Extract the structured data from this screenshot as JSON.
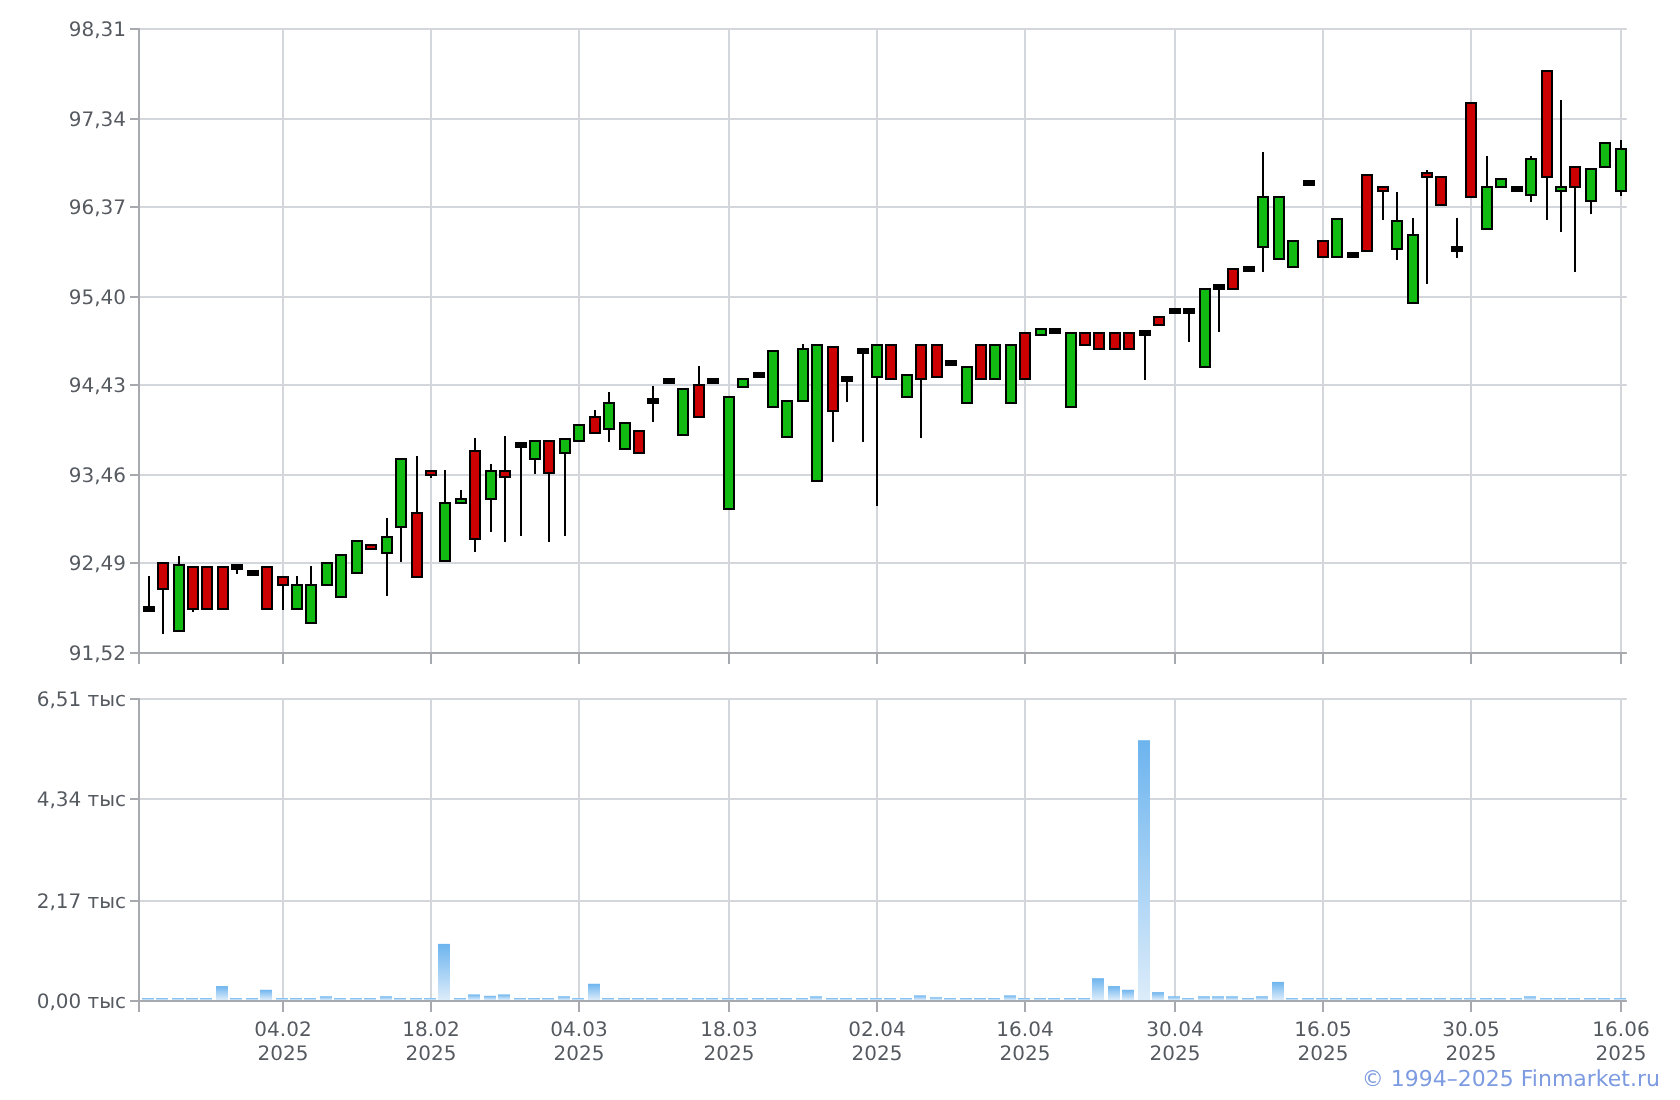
{
  "price_chart": {
    "chart_data": {
      "type": "candlestick",
      "grid": true,
      "ylim": [
        91.52,
        98.31
      ],
      "yticks": [
        {
          "value": 98.31,
          "label": "98,31"
        },
        {
          "value": 97.34,
          "label": "97,34"
        },
        {
          "value": 96.37,
          "label": "96,37"
        },
        {
          "value": 95.4,
          "label": "95,40"
        },
        {
          "value": 94.43,
          "label": "94,43"
        },
        {
          "value": 93.46,
          "label": "93,46"
        },
        {
          "value": 92.49,
          "label": "92,49"
        },
        {
          "value": 91.52,
          "label": "91,52"
        }
      ],
      "categories": [
        null,
        null,
        null,
        null,
        null,
        null,
        null,
        null,
        null,
        null,
        null,
        null,
        null,
        null,
        null,
        null,
        null,
        null,
        null,
        null,
        null,
        null,
        null,
        null,
        null,
        null,
        null,
        null,
        null,
        null,
        null,
        null,
        null,
        null,
        null,
        null,
        null,
        null,
        null,
        null,
        null,
        null,
        null,
        null,
        null,
        null,
        null,
        null,
        null,
        null,
        null,
        null,
        null,
        null,
        null,
        null,
        null,
        null,
        null,
        null,
        null,
        null,
        null,
        null,
        null,
        null,
        null,
        null,
        null,
        null,
        null,
        null,
        null,
        null,
        null,
        null,
        null,
        null,
        null,
        null,
        null,
        null,
        null,
        null,
        null,
        null,
        null,
        null,
        null,
        null,
        null,
        null,
        null,
        null,
        null,
        null,
        null,
        null,
        null,
        null
      ],
      "ohlc": [
        [
          92.0,
          92.35,
          92.0,
          92.0
        ],
        [
          92.5,
          92.5,
          91.74,
          92.22
        ],
        [
          91.76,
          92.57,
          91.76,
          92.48
        ],
        [
          92.46,
          92.46,
          91.98,
          92.0
        ],
        [
          92.46,
          92.46,
          92.0,
          92.0
        ],
        [
          92.46,
          92.46,
          92.0,
          92.0
        ],
        [
          92.46,
          92.46,
          92.39,
          92.46
        ],
        [
          92.39,
          92.39,
          92.39,
          92.39
        ],
        [
          92.46,
          92.46,
          92.0,
          92.0
        ],
        [
          92.35,
          92.35,
          92.0,
          92.26
        ],
        [
          92.0,
          92.35,
          92.0,
          92.26
        ],
        [
          91.85,
          92.46,
          91.85,
          92.26
        ],
        [
          92.26,
          92.5,
          92.26,
          92.5
        ],
        [
          92.13,
          92.59,
          92.13,
          92.59
        ],
        [
          92.39,
          92.74,
          92.39,
          92.74
        ],
        [
          92.7,
          92.7,
          92.65,
          92.65
        ],
        [
          92.61,
          92.98,
          92.15,
          92.78
        ],
        [
          92.89,
          93.63,
          92.52,
          93.63
        ],
        [
          93.04,
          93.65,
          92.35,
          92.35
        ],
        [
          93.5,
          93.5,
          93.44,
          93.46
        ],
        [
          92.52,
          93.5,
          92.52,
          93.15
        ],
        [
          93.15,
          93.28,
          93.15,
          93.2
        ],
        [
          93.72,
          93.85,
          92.63,
          92.76
        ],
        [
          93.2,
          93.57,
          92.85,
          93.5
        ],
        [
          93.5,
          93.87,
          92.74,
          93.44
        ],
        [
          93.78,
          93.78,
          92.8,
          93.78
        ],
        [
          93.63,
          93.83,
          93.48,
          93.83
        ],
        [
          93.83,
          93.83,
          92.74,
          93.48
        ],
        [
          93.7,
          93.85,
          92.8,
          93.85
        ],
        [
          93.83,
          94.0,
          93.83,
          94.0
        ],
        [
          94.09,
          94.15,
          93.92,
          93.92
        ],
        [
          93.96,
          94.35,
          93.83,
          94.24
        ],
        [
          93.74,
          94.02,
          93.74,
          94.02
        ],
        [
          93.94,
          93.94,
          93.7,
          93.7
        ],
        [
          94.26,
          94.41,
          94.05,
          94.26
        ],
        [
          94.48,
          94.48,
          94.48,
          94.48
        ],
        [
          93.89,
          94.39,
          93.89,
          94.39
        ],
        [
          94.44,
          94.63,
          94.09,
          94.09
        ],
        [
          94.48,
          94.48,
          94.48,
          94.48
        ],
        [
          93.09,
          94.31,
          93.09,
          94.31
        ],
        [
          94.41,
          94.5,
          94.41,
          94.5
        ],
        [
          94.55,
          94.55,
          94.55,
          94.55
        ],
        [
          94.2,
          94.81,
          94.2,
          94.81
        ],
        [
          93.87,
          94.26,
          93.87,
          94.26
        ],
        [
          94.26,
          94.87,
          94.26,
          94.83
        ],
        [
          93.39,
          94.87,
          93.39,
          94.87
        ],
        [
          94.85,
          94.85,
          93.83,
          94.15
        ],
        [
          94.5,
          94.5,
          94.26,
          94.5
        ],
        [
          94.81,
          94.81,
          93.83,
          94.81
        ],
        [
          94.52,
          94.87,
          93.13,
          94.87
        ],
        [
          94.87,
          94.87,
          94.5,
          94.5
        ],
        [
          94.31,
          94.55,
          94.31,
          94.55
        ],
        [
          94.87,
          94.87,
          93.87,
          94.5
        ],
        [
          94.87,
          94.87,
          94.52,
          94.52
        ],
        [
          94.68,
          94.68,
          94.68,
          94.68
        ],
        [
          94.24,
          94.63,
          94.24,
          94.63
        ],
        [
          94.87,
          94.87,
          94.5,
          94.5
        ],
        [
          94.5,
          94.87,
          94.5,
          94.87
        ],
        [
          94.24,
          94.87,
          94.24,
          94.87
        ],
        [
          95.0,
          95.0,
          94.5,
          94.5
        ],
        [
          94.98,
          95.05,
          94.98,
          95.05
        ],
        [
          95.02,
          95.02,
          95.02,
          95.02
        ],
        [
          94.2,
          95.0,
          94.2,
          95.0
        ],
        [
          95.0,
          95.0,
          94.87,
          94.87
        ],
        [
          95.0,
          95.0,
          94.83,
          94.83
        ],
        [
          95.0,
          95.0,
          94.83,
          94.83
        ],
        [
          95.0,
          95.0,
          94.83,
          94.83
        ],
        [
          95.0,
          95.0,
          94.5,
          95.0
        ],
        [
          95.18,
          95.18,
          95.09,
          95.09
        ],
        [
          95.24,
          95.24,
          95.24,
          95.24
        ],
        [
          95.24,
          95.24,
          94.91,
          95.24
        ],
        [
          94.63,
          95.48,
          94.63,
          95.48
        ],
        [
          95.5,
          95.5,
          95.02,
          95.5
        ],
        [
          95.7,
          95.7,
          95.48,
          95.48
        ],
        [
          95.7,
          95.7,
          95.7,
          95.7
        ],
        [
          95.94,
          96.96,
          95.68,
          96.48
        ],
        [
          95.81,
          96.48,
          95.81,
          96.48
        ],
        [
          95.72,
          96.0,
          95.72,
          96.0
        ],
        [
          96.63,
          96.63,
          96.63,
          96.63
        ],
        [
          96.0,
          96.0,
          95.83,
          95.83
        ],
        [
          95.83,
          96.24,
          95.83,
          96.24
        ],
        [
          95.85,
          95.85,
          95.85,
          95.85
        ],
        [
          96.72,
          96.72,
          95.89,
          95.89
        ],
        [
          96.59,
          96.59,
          96.24,
          96.55
        ],
        [
          95.92,
          96.53,
          95.81,
          96.22
        ],
        [
          95.33,
          96.24,
          95.33,
          96.07
        ],
        [
          96.74,
          96.76,
          95.55,
          96.7
        ],
        [
          96.7,
          96.7,
          96.39,
          96.39
        ],
        [
          95.92,
          96.24,
          95.83,
          95.92
        ],
        [
          97.5,
          97.5,
          96.48,
          96.48
        ],
        [
          96.13,
          96.92,
          96.13,
          96.59
        ],
        [
          96.59,
          96.68,
          96.59,
          96.68
        ],
        [
          96.57,
          96.57,
          96.57,
          96.57
        ],
        [
          96.5,
          96.92,
          96.44,
          96.9
        ],
        [
          97.85,
          97.85,
          96.24,
          96.7
        ],
        [
          96.55,
          97.52,
          96.11,
          96.59
        ],
        [
          96.81,
          96.81,
          95.68,
          96.59
        ],
        [
          96.44,
          96.79,
          96.31,
          96.79
        ],
        [
          96.81,
          97.07,
          96.81,
          97.07
        ],
        [
          96.55,
          97.09,
          96.5,
          97.0
        ]
      ]
    }
  },
  "volume_chart": {
    "chart_data": {
      "type": "bar",
      "grid": true,
      "ylim": [
        0,
        6.51
      ],
      "yticks": [
        {
          "value": 6.51,
          "label": "6,51 тыс"
        },
        {
          "value": 4.34,
          "label": "4,34 тыс"
        },
        {
          "value": 2.17,
          "label": "2,17 тыс"
        },
        {
          "value": 0,
          "label": "0,00 тыс"
        }
      ],
      "categories": [
        null,
        null,
        null,
        null,
        null,
        null,
        null,
        null,
        null,
        "04.02 2025",
        null,
        null,
        null,
        null,
        null,
        null,
        null,
        null,
        null,
        "18.02 2025",
        null,
        null,
        null,
        null,
        null,
        null,
        null,
        null,
        null,
        "04.03 2025",
        null,
        null,
        null,
        null,
        null,
        null,
        null,
        null,
        null,
        "18.03 2025",
        null,
        null,
        null,
        null,
        null,
        null,
        null,
        null,
        null,
        "02.04 2025",
        null,
        null,
        null,
        null,
        null,
        null,
        null,
        null,
        null,
        "16.04 2025",
        null,
        null,
        null,
        null,
        null,
        null,
        null,
        null,
        null,
        "30.04 2025",
        null,
        null,
        null,
        null,
        null,
        null,
        null,
        null,
        null,
        "16.05 2025",
        null,
        null,
        null,
        null,
        null,
        null,
        null,
        null,
        null,
        "30.05 2025",
        null,
        null,
        null,
        null,
        null,
        null,
        null,
        null,
        null,
        "16.06 2025"
      ],
      "values": [
        0.03,
        0.03,
        0.03,
        0.03,
        0.03,
        0.3,
        0.03,
        0.03,
        0.22,
        0.03,
        0.03,
        0.03,
        0.08,
        0.03,
        0.03,
        0.03,
        0.08,
        0.03,
        0.03,
        0.03,
        1.21,
        0.03,
        0.12,
        0.09,
        0.12,
        0.03,
        0.03,
        0.03,
        0.08,
        0.03,
        0.35,
        0.03,
        0.03,
        0.03,
        0.03,
        0.03,
        0.03,
        0.03,
        0.03,
        0.03,
        0.03,
        0.03,
        0.03,
        0.03,
        0.03,
        0.08,
        0.03,
        0.03,
        0.03,
        0.03,
        0.03,
        0.03,
        0.1,
        0.06,
        0.03,
        0.03,
        0.03,
        0.03,
        0.1,
        0.03,
        0.03,
        0.03,
        0.03,
        0.03,
        0.47,
        0.3,
        0.22,
        5.6,
        0.17,
        0.08,
        0.03,
        0.08,
        0.08,
        0.08,
        0.03,
        0.08,
        0.39,
        0.03,
        0.03,
        0.03,
        0.03,
        0.03,
        0.03,
        0.03,
        0.03,
        0.03,
        0.03,
        0.03,
        0.03,
        0.03,
        0.03,
        0.03,
        0.03,
        0.08,
        0.03,
        0.03,
        0.03,
        0.03,
        0.03,
        0.03
      ]
    }
  },
  "copyright": "© 1994–2025 Finmarket.ru"
}
